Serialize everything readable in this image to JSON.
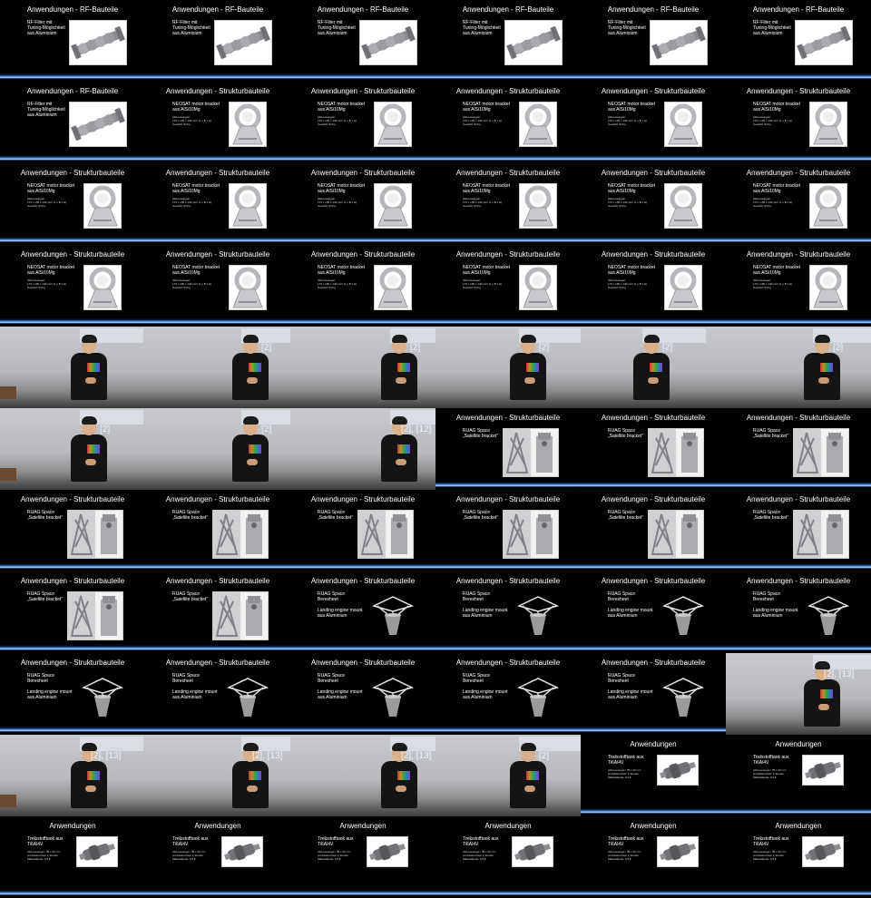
{
  "slides": {
    "rf": {
      "title": "Anwendungen - RF-Bauteile",
      "text": "RF-Filter mit\nTuning-Möglichkeit\naus Aluminium",
      "image": "rf-filter-part"
    },
    "neosat": {
      "title": "Anwendungen - Strukturbauteile",
      "text": "NEOSAT motor bracket\naus AlSi10Mg",
      "sub": "Abmessungen:\n170 x 160 x 140 mm³ (L x B x H)\nGewicht: 510 g",
      "image": "motor-bracket-part"
    },
    "ruag_bracket": {
      "title": "Anwendungen - Strukturbauteile",
      "text": "RUAG Space\n„Satellite bracket“",
      "image": "satellite-bracket-part"
    },
    "ruag_mount": {
      "title": "Anwendungen - Strukturbauteile",
      "text": "RUAG Space\nBeresheet\n\nLanding engine mount\naus Aluminium",
      "image": "engine-mount-part"
    },
    "tibehaelter": {
      "title": "Anwendungen",
      "text": "Treibstofftank aus\nTi6Al4V",
      "sub": "Abmessungen: 35 x 32 mm\nproduktionszeit: 1 Stunde\nMaterialpreis: 3.6 €",
      "image": "titanium-tank-part"
    }
  },
  "refs": {
    "r2": "[2]",
    "r2_12": "[2], [12]",
    "r2_13": "[2], [13]"
  },
  "frames": [
    "rf",
    "rf",
    "rf",
    "rf",
    "rf",
    "rf",
    "rf",
    "neosat",
    "neosat",
    "neosat",
    "neosat",
    "neosat",
    "neosat",
    "neosat",
    "neosat",
    "neosat",
    "neosat",
    "neosat",
    "neosat",
    "neosat",
    "neosat",
    "neosat",
    "neosat",
    "neosat",
    "speaker:",
    "speaker:r2",
    "speaker:r2",
    "speaker:r2",
    "speaker:r2",
    "speaker:r2",
    "speaker:r2",
    "speaker:r2",
    "speaker:r2_12",
    "ruag_bracket",
    "ruag_bracket",
    "ruag_bracket",
    "ruag_bracket",
    "ruag_bracket",
    "ruag_bracket",
    "ruag_bracket",
    "ruag_bracket",
    "ruag_bracket",
    "ruag_bracket",
    "ruag_bracket",
    "ruag_mount",
    "ruag_mount",
    "ruag_mount",
    "ruag_mount",
    "ruag_mount",
    "ruag_mount",
    "ruag_mount",
    "ruag_mount",
    "ruag_mount",
    "speaker:r2_13",
    "speaker:r2_13",
    "speaker:r2_13",
    "speaker:r2_13",
    "speaker:r2",
    "tibehaelter",
    "tibehaelter",
    "tibehaelter",
    "tibehaelter",
    "tibehaelter",
    "tibehaelter",
    "tibehaelter",
    "tibehaelter"
  ],
  "colors": {
    "slide_bg": "#000000",
    "slide_text": "#ffffff",
    "ref_text": "#eef2ff"
  }
}
